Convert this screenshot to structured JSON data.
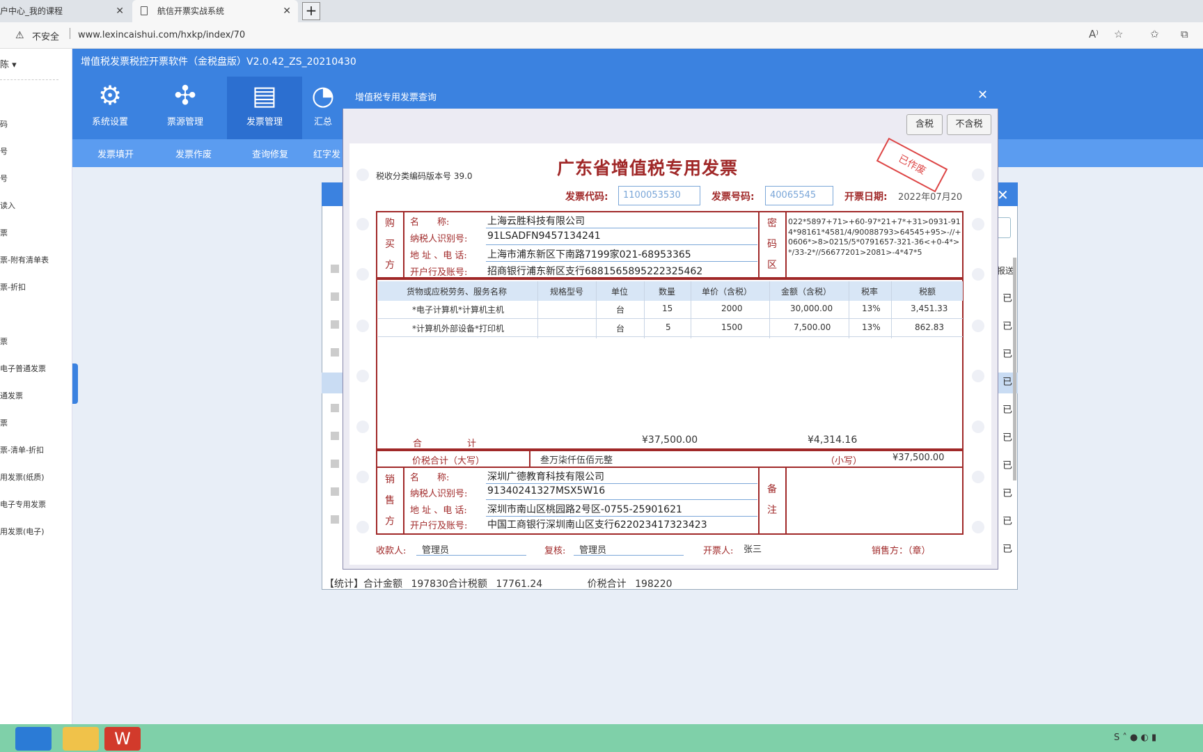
{
  "browser": {
    "tabs": [
      {
        "label": "户中心_我的课程"
      },
      {
        "label": "航信开票实战系统"
      }
    ],
    "security": "不安全",
    "url": "www.lexincaishui.com/hxkp/index/70"
  },
  "app": {
    "title": "增值税发票税控开票软件（金税盘版）V2.0.42_ZS_20210430",
    "modules": [
      {
        "label": "系统设置",
        "icon": "gear-icon"
      },
      {
        "label": "票源管理",
        "icon": "network-icon"
      },
      {
        "label": "发票管理",
        "icon": "invoice-icon"
      },
      {
        "label": "汇总"
      }
    ],
    "subnav": [
      "发票填开",
      "发票作废",
      "查询修复",
      "红字发"
    ],
    "left_items": [
      "陈 ▾",
      "码",
      "号",
      "号",
      "读入",
      "票",
      "票-附有清单表",
      "票-折扣",
      "票",
      "电子普通发票",
      "通发票",
      "票",
      "票-清单-折扣",
      "用发票(纸质)",
      "电子专用发票",
      "用发票(电子)"
    ]
  },
  "background_window": {
    "stat_label": "【统计】合计金额",
    "stat_amount": "197830",
    "stat_tax_label": "合计税额",
    "stat_tax": "17761.24",
    "stat_total_label": "价税合计",
    "stat_total": "198220",
    "col_label": "报送",
    "row_status": "已"
  },
  "dialog": {
    "title": "增值税专用发票查询",
    "btn_tax_incl": "含税",
    "btn_tax_excl": "不含税"
  },
  "invoice": {
    "title": "广东省增值税专用发票",
    "stamp": "已作废",
    "tax_code_version": "税收分类编码版本号 39.0",
    "code_label": "发票代码:",
    "code": "1100053530",
    "number_label": "发票号码:",
    "number": "40065545",
    "date_label": "开票日期:",
    "date": "2022年07月20",
    "buyer_side": "购买方",
    "cipher_side": "密码区",
    "cipher": "022*5897+71>+60-97*21+7*+31>0931-914*98161*4581/4/90088793>64545+95>-//+0606*>8>0215/5*0791657-321-36<+0-4*>*/33-2*//56677201>2081>-4*47*5",
    "field_labels": [
      "名　　称:",
      "纳税人识别号:",
      "地 址 、电 话:",
      "开户行及账号:"
    ],
    "buyer": {
      "name": "上海云胜科技有限公司",
      "tax_id": "91LSADFN9457134241",
      "address_phone": "上海市浦东新区下南路7199家021-68953365",
      "bank": "招商银行浦东新区支行6881565895222325462"
    },
    "item_headers": [
      "货物或应税劳务、服务名称",
      "规格型号",
      "单位",
      "数量",
      "单价（含税）",
      "金额（含税）",
      "税率",
      "税额"
    ],
    "items": [
      {
        "name": "*电子计算机*计算机主机",
        "spec": "",
        "unit": "台",
        "qty": "15",
        "price": "2000",
        "amount": "30,000.00",
        "rate": "13%",
        "tax": "3,451.33"
      },
      {
        "name": "*计算机外部设备*打印机",
        "spec": "",
        "unit": "台",
        "qty": "5",
        "price": "1500",
        "amount": "7,500.00",
        "rate": "13%",
        "tax": "862.83"
      }
    ],
    "total_label": "合　　　　　计",
    "total_amount": "¥37,500.00",
    "total_tax": "¥4,314.16",
    "grand_label": "价税合计（大写）",
    "grand_words": "叁万柒仟伍佰元整",
    "small_label": "（小写）",
    "grand_small": "¥37,500.00",
    "seller_side": "销售方",
    "seller": {
      "name": "深圳广德教育科技有限公司",
      "tax_id": "91340241327MSX5W16",
      "address_phone": "深圳市南山区桃园路2号区-0755-25901621",
      "bank": "中国工商银行深圳南山区支行622023417323423"
    },
    "remark_side": "备注",
    "payee_label": "收款人:",
    "payee": "管理员",
    "reviewer_label": "复核:",
    "reviewer": "管理员",
    "issuer_label": "开票人:",
    "issuer": "张三",
    "seller_seal_label": "销售方：（章）"
  }
}
